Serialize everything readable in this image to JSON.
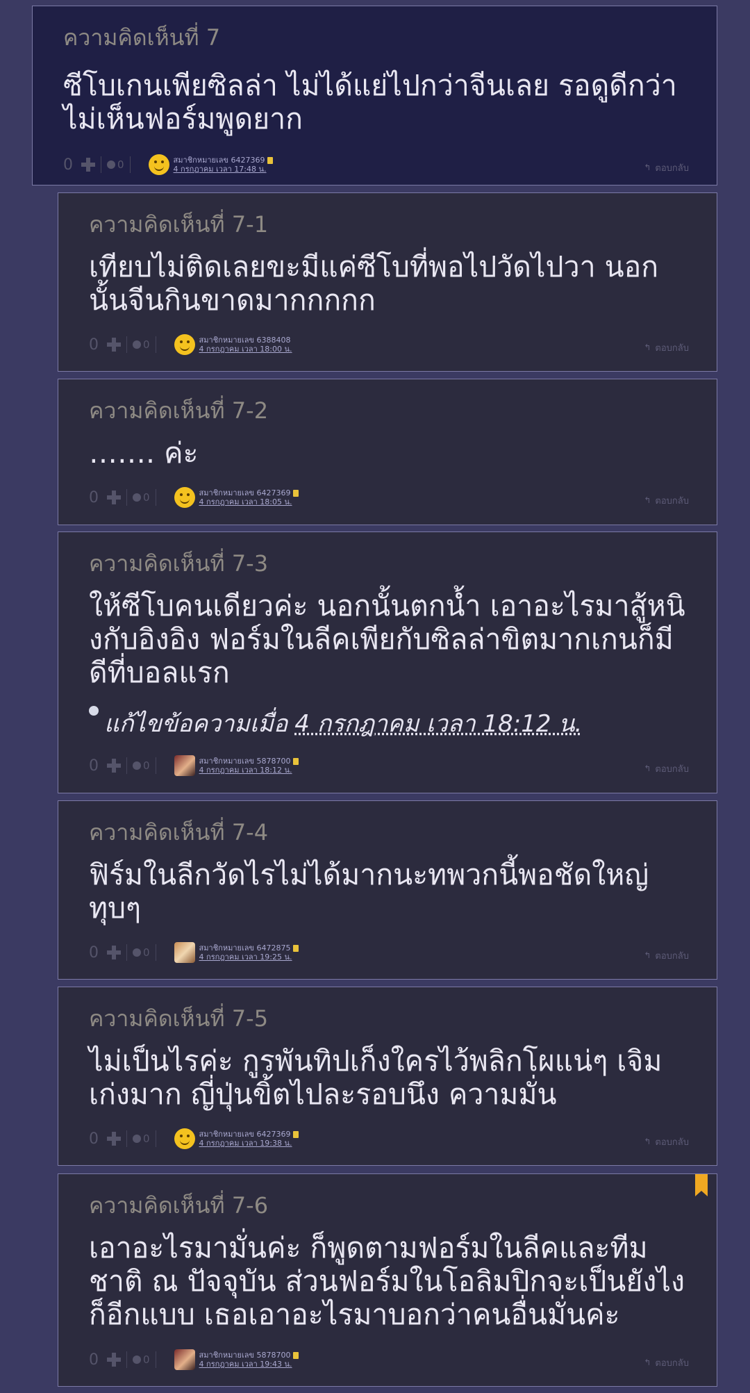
{
  "ui": {
    "edited_prefix": "แก้ไขข้อความเมื่อ",
    "reply_label": "ตอบกลับ"
  },
  "comments": [
    {
      "header": "ความคิดเห็นที่ 7",
      "body": "ซีโบเกนเพียซิลล่า ไม่ได้แย่ไปกว่าจีนเลย รอดูดีกว่า ไม่เห็นฟอร์มพูดยาก",
      "votes": "0",
      "emotions": "0",
      "avatar": "smiley",
      "member": "สมาชิกหมายเลข 6427369",
      "time": "4 กรกฎาคม เวลา 17:48 น."
    },
    {
      "header": "ความคิดเห็นที่ 7-1",
      "body": "เทียบไม่ติดเลยขะมีแค่ซีโบที่พอไปวัดไปวา นอกนั้นจีนกินขาดมากกกกก",
      "votes": "0",
      "emotions": "0",
      "avatar": "smiley",
      "member": "สมาชิกหมายเลข 6388408",
      "time": "4 กรกฎาคม เวลา 18:00 น."
    },
    {
      "header": "ความคิดเห็นที่ 7-2",
      "body": "…….  ค่ะ",
      "votes": "0",
      "emotions": "0",
      "avatar": "smiley",
      "member": "สมาชิกหมายเลข 6427369",
      "time": "4 กรกฎาคม เวลา 18:05 น."
    },
    {
      "header": "ความคิดเห็นที่ 7-3",
      "body": "ให้ซีโบคนเดียวค่ะ นอกนั้นตกน้ำ เอาอะไรมาสู้หนิงกับอิงอิง ฟอร์มในลีคเพียกับซิลล่าขิตมากเกนก็มีดีที่บอลแรก",
      "edited_time": "4 กรกฎาคม เวลา 18:12 น.",
      "votes": "0",
      "emotions": "0",
      "avatar": "photo",
      "member": "สมาชิกหมายเลข 5878700",
      "time": "4 กรกฎาคม เวลา 18:12 น."
    },
    {
      "header": "ความคิดเห็นที่ 7-4",
      "body": "ฟิร์มในลีกวัดไรไม่ได้มากนะทพวกนี้พอชัดใหญ่ทุบๆ",
      "votes": "0",
      "emotions": "0",
      "avatar": "photo",
      "member": "สมาชิกหมายเลข 6472875",
      "time": "4 กรกฎาคม เวลา 19:25 น."
    },
    {
      "header": "ความคิดเห็นที่ 7-5",
      "body": "ไม่เป็นไรค่ะ กูรพันทิปเก็งใครไว้พลิกโผแน่ๆ เจิมเก่งมาก ญี่ปุ่นขิ้ตไปละรอบนึง ความมั่น",
      "votes": "0",
      "emotions": "0",
      "avatar": "smiley",
      "member": "สมาชิกหมายเลข 6427369",
      "time": "4 กรกฎาคม เวลา 19:38 น."
    },
    {
      "header": "ความคิดเห็นที่ 7-6",
      "body": "เอาอะไรมามั่นค่ะ ก็พูดตามฟอร์มในลีคและทีมชาติ ณ ปัจจุบัน ส่วนฟอร์มในโอลิมปิกจะเป็นยังไงก็อีกแบบ เธอเอาอะไรมาบอกว่าคนอื่นมั่นค่ะ",
      "votes": "0",
      "emotions": "0",
      "avatar": "photo",
      "member": "สมาชิกหมายเลข 5878700",
      "time": "4 กรกฎาคม เวลา 19:43 น."
    }
  ]
}
